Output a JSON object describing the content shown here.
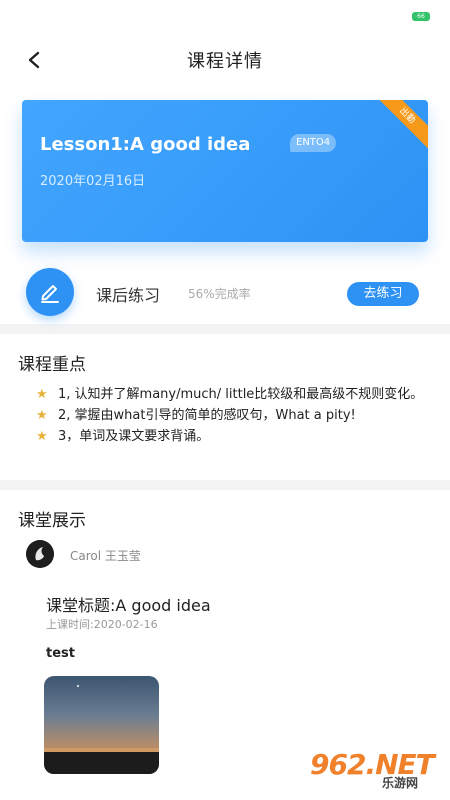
{
  "status_bar": {
    "battery": "66"
  },
  "nav": {
    "title": "课程详情"
  },
  "banner": {
    "lesson_title": "Lesson1:A good idea",
    "date": "2020年02月16日",
    "level_badge": "ENTO4",
    "corner_label": "出勤"
  },
  "practice": {
    "label": "课后练习",
    "rate": "56%完成率",
    "button": "去练习"
  },
  "key_points": {
    "title": "课程重点",
    "items": [
      "1, 认知并了解many/much/ little比较级和最高级不规则变化。",
      "2, 掌握由what引导的简单的感叹句，What a pity!",
      "3，单词及课文要求背诵。"
    ]
  },
  "classroom": {
    "title": "课堂展示",
    "teacher_name": "Carol  王玉莹",
    "class_title": "课堂标题:A good idea",
    "class_time": "上课时间:2020-02-16",
    "description": "test"
  },
  "watermark": {
    "brand": "962.NET",
    "sub": "乐游网"
  },
  "colors": {
    "primary": "#2e92f5",
    "star": "#e8b23a",
    "ribbon": "#f79a1a"
  }
}
